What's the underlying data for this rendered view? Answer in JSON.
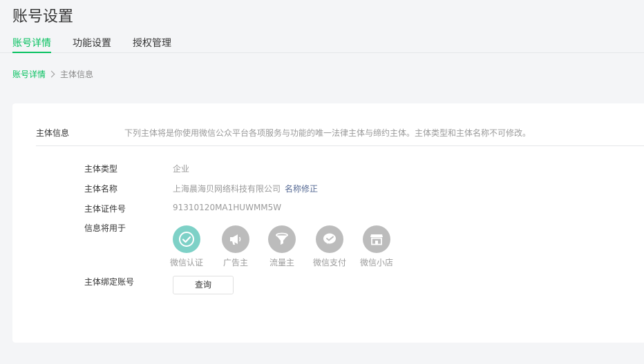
{
  "page_title": "账号设置",
  "tabs": [
    {
      "label": "账号详情",
      "active": true
    },
    {
      "label": "功能设置",
      "active": false
    },
    {
      "label": "授权管理",
      "active": false
    }
  ],
  "breadcrumb": {
    "parent": "账号详情",
    "current": "主体信息"
  },
  "section": {
    "title": "主体信息",
    "description": "下列主体将是你使用微信公众平台各项服务与功能的唯一法律主体与缔约主体。主体类型和主体名称不可修改。"
  },
  "fields": {
    "type_label": "主体类型",
    "type_value": "企业",
    "name_label": "主体名称",
    "name_value": "上海晨海贝网络科技有限公司",
    "name_edit_link": "名称修正",
    "cert_label": "主体证件号",
    "cert_value": "91310120MA1HUWMM5W",
    "uses_label": "信息将用于",
    "bind_label": "主体绑定账号",
    "query_button": "查询"
  },
  "uses": [
    {
      "label": "微信认证",
      "icon": "check-icon",
      "active": true
    },
    {
      "label": "广告主",
      "icon": "megaphone-icon",
      "active": false
    },
    {
      "label": "流量主",
      "icon": "funnel-icon",
      "active": false
    },
    {
      "label": "微信支付",
      "icon": "pay-icon",
      "active": false
    },
    {
      "label": "微信小店",
      "icon": "store-icon",
      "active": false
    }
  ],
  "colors": {
    "accent": "#07c160",
    "link": "#576b95",
    "active_icon_bg": "#7ed1c7",
    "inactive_icon_bg": "#bcbcbc"
  }
}
